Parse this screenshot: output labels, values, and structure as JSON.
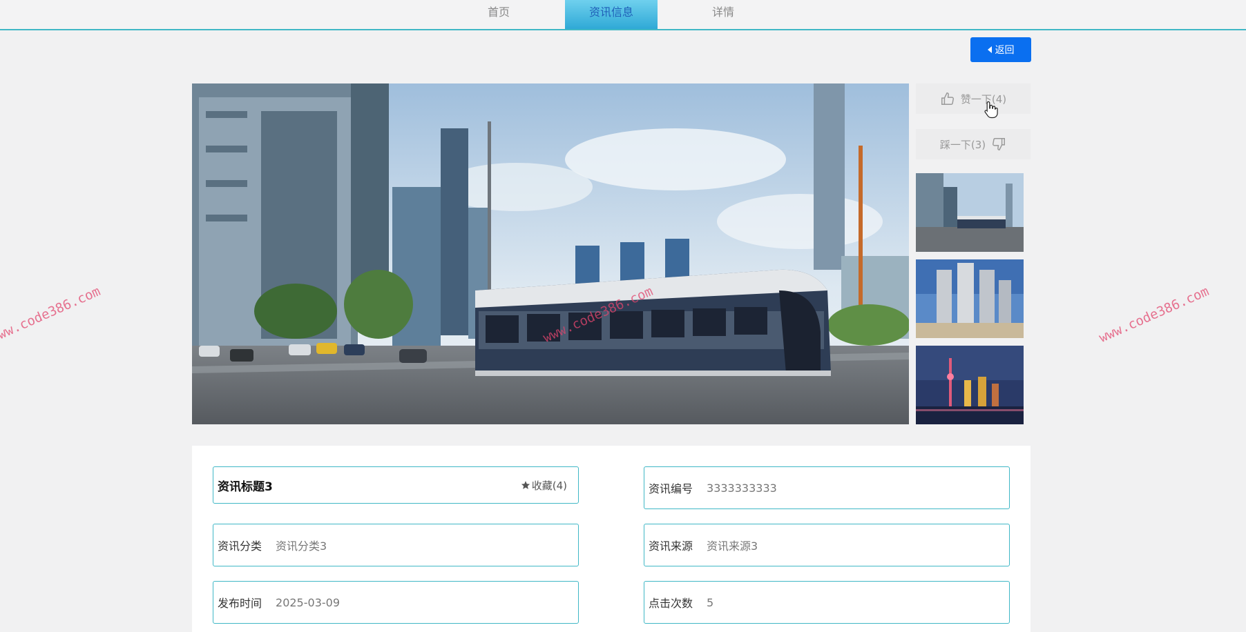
{
  "nav": {
    "items": [
      {
        "label": "首页"
      },
      {
        "label": "资讯信息"
      },
      {
        "label": "详情"
      }
    ],
    "active_index": 1
  },
  "actions": {
    "back_label": "返回",
    "like_label": "赞一下(4)",
    "dislike_label": "踩一下(3)"
  },
  "gallery": {
    "main_image": "city-tram-photo",
    "thumbnails": [
      "city-tram-thumb",
      "highrise-buildings-thumb",
      "night-skyline-thumb"
    ]
  },
  "detail": {
    "title": "资讯标题3",
    "favorite_label": "收藏(4)",
    "fields": [
      {
        "label": "资讯编号",
        "value": "3333333333"
      },
      {
        "label": "资讯分类",
        "value": "资讯分类3"
      },
      {
        "label": "资讯来源",
        "value": "资讯来源3"
      },
      {
        "label": "发布时间",
        "value": "2025-03-09"
      },
      {
        "label": "点击次数",
        "value": "5"
      }
    ]
  },
  "watermark": "www.code386.com",
  "colors": {
    "accent": "#3fb7c6",
    "primary_button": "#0a6ff0",
    "active_tab_text": "#1f5fb8",
    "watermark": "#e1466e"
  }
}
